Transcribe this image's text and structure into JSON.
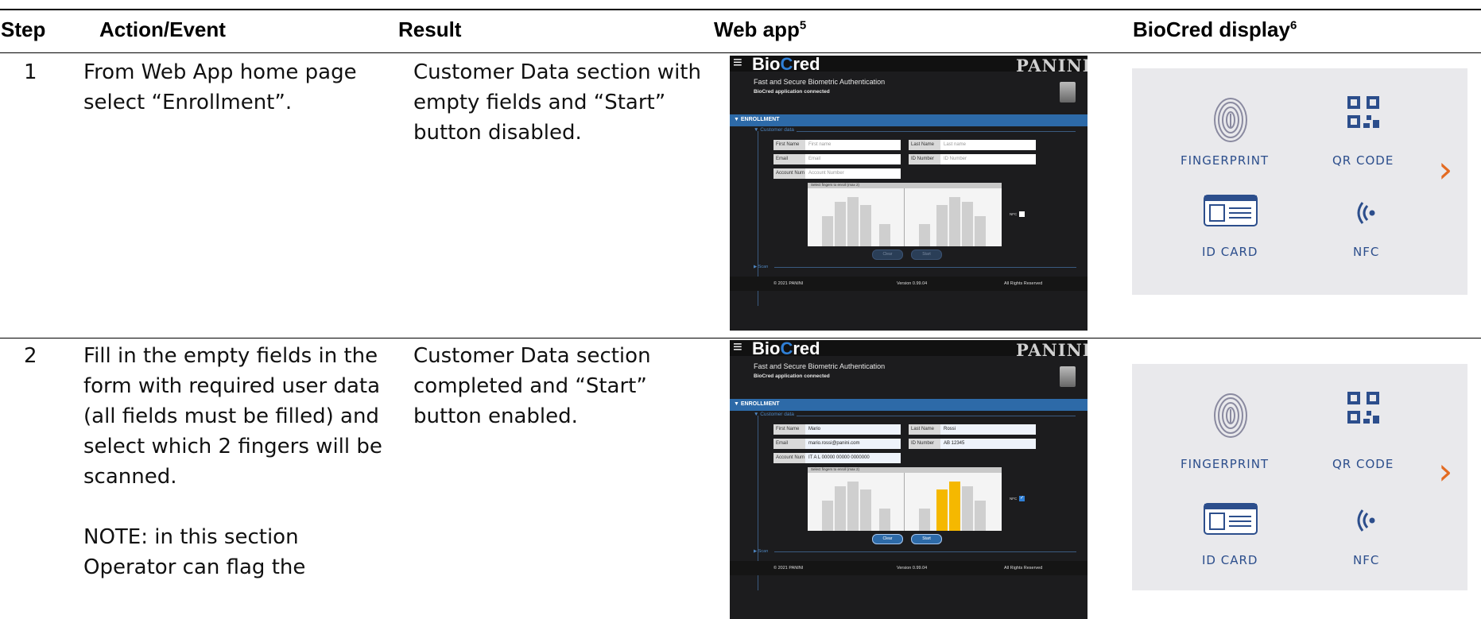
{
  "table": {
    "headers": {
      "step": "Step",
      "action": "Action/Event",
      "result": "Result",
      "webapp": "Web app",
      "webapp_sup": "5",
      "display": "BioCred display",
      "display_sup": "6"
    },
    "rows": [
      {
        "step": "1",
        "action": [
          "From Web App home page",
          "select “Enrollment”."
        ],
        "result": [
          "Customer Data section with",
          "empty fields and “Start”",
          "button disabled."
        ]
      },
      {
        "step": "2",
        "action": [
          "Fill in the empty fields in the",
          "form with required user data",
          "(all fields must be filled) and",
          "select which 2 fingers will be",
          "scanned.",
          "",
          "NOTE: in this section",
          "Operator can flag the"
        ],
        "result": [
          "Customer Data section",
          "completed and “Start”",
          "button enabled."
        ]
      }
    ]
  },
  "webapp": {
    "menu_icon": "≡",
    "brand_part1": "Bio",
    "brand_part2": "C",
    "brand_part3": "red",
    "logo": "PANINI",
    "subtitle": "Fast and Secure Biometric Authentication",
    "connected": "BioCred application connected",
    "section_bar": "▼ ENROLLMENT",
    "customer_data": "▼ Customer data",
    "labels": {
      "first_name": "First Name",
      "last_name": "Last Name",
      "email": "Email",
      "id_number": "ID Number",
      "account_num": "Account Num"
    },
    "empty": {
      "first_name": "First name",
      "last_name": "Last name",
      "email": "Email",
      "id_number": "ID Number",
      "account_num": "Account Number"
    },
    "filled": {
      "first_name": "Mario",
      "last_name": "Rossi",
      "email": "mario.rossi@panini.com",
      "id_number": "AB 12345",
      "account_num": "IT A L 00000 00000 0000000"
    },
    "finger_label": "Select fingers to enroll (max 2)",
    "nfc": "NFC",
    "clear": "Clear",
    "start": "Start",
    "scan": "▶ Scan",
    "footer_left": "© 2021 PANINI",
    "footer_mid": "Version 0.99.04",
    "footer_right": "All Rights Reserved"
  },
  "bio": {
    "fingerprint": "FINGERPRINT",
    "qr": "QR CODE",
    "idcard": "ID CARD",
    "nfc": "NFC",
    "next": "›",
    "accent": "#e36b22",
    "text_color": "#2c4e8c"
  }
}
